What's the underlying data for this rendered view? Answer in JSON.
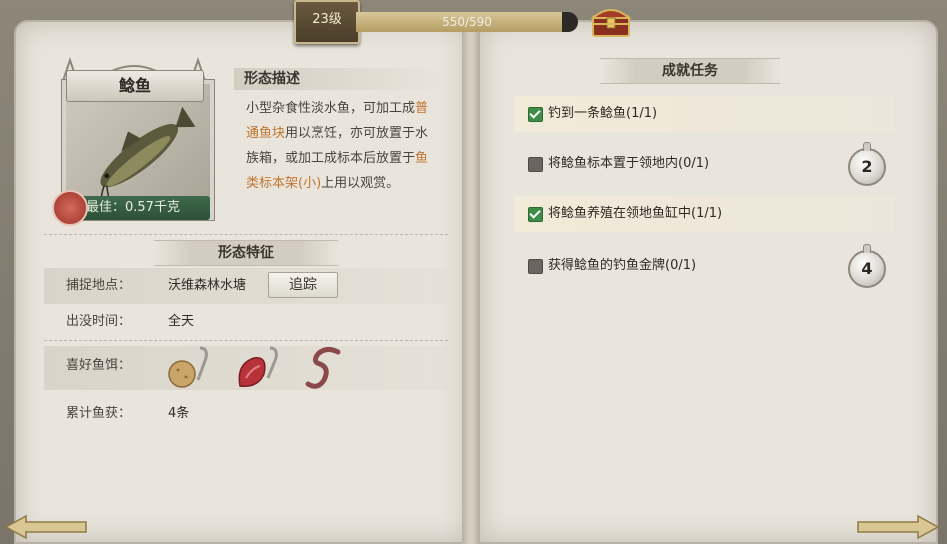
{
  "header": {
    "level_label": "23级",
    "xp_text": "550/590",
    "xp_progress": 0.93
  },
  "fish": {
    "name": "鲶鱼",
    "best_label": "最佳：0.57千克"
  },
  "description": {
    "title": "形态描述",
    "part1": "小型杂食性淡水鱼，可加工成",
    "link1": "普通鱼块",
    "part2": "用以烹饪，亦可放置于水族箱，或加工成标本后放置于",
    "link2": "鱼类标本架(小)",
    "part3": "上用以观赏。"
  },
  "features": {
    "title": "形态特征",
    "location_key": "捕捉地点：",
    "location_value": "沃维森林水塘",
    "track_button": "追踪",
    "time_key": "出没时间：",
    "time_value": "全天",
    "bait_key": "喜好鱼饵：",
    "baits": [
      "bread-bait-icon",
      "meat-bait-icon",
      "worm-bait-icon"
    ],
    "catch_key": "累计鱼获：",
    "catch_value": "4条"
  },
  "achievements": {
    "title": "成就任务",
    "tasks": [
      {
        "label": "钓到一条鲶鱼(1/1)",
        "done": true
      },
      {
        "label": "将鲶鱼标本置于领地内(0/1)",
        "done": false,
        "reward": "2"
      },
      {
        "label": "将鲶鱼养殖在领地鱼缸中(1/1)",
        "done": true
      },
      {
        "label": "获得鲶鱼的钓鱼金牌(0/1)",
        "done": false,
        "reward": "4"
      }
    ]
  },
  "colors": {
    "check_done": "#3e8d46",
    "highlight": "#c0742e",
    "xp_fill": "#c9b47c"
  }
}
